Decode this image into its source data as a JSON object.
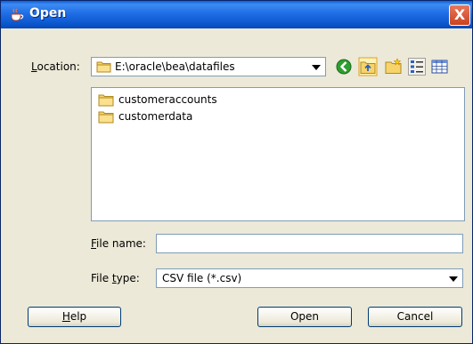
{
  "window": {
    "title": "Open",
    "title_icon": "java-cup-icon",
    "close_glyph": "X"
  },
  "location": {
    "label_underlined": "L",
    "label_rest": "ocation:",
    "value": "E:\\oracle\\bea\\datafiles",
    "icon": "folder-icon"
  },
  "toolbar": [
    {
      "name": "back-icon"
    },
    {
      "name": "up-folder-icon"
    },
    {
      "name": "new-folder-icon"
    },
    {
      "name": "list-view-icon"
    },
    {
      "name": "details-view-icon"
    }
  ],
  "files": [
    {
      "name": "customeraccounts",
      "icon": "folder-icon"
    },
    {
      "name": "customerdata",
      "icon": "folder-icon"
    }
  ],
  "file_name": {
    "label_underlined": "F",
    "label_rest": "ile name:",
    "value": ""
  },
  "file_type": {
    "label_pre": "File ",
    "label_underlined": "t",
    "label_rest": "ype:",
    "value": "CSV file (*.csv)"
  },
  "buttons": {
    "help_underlined": "H",
    "help_rest": "elp",
    "open": "Open",
    "cancel": "Cancel"
  },
  "colors": {
    "title_bar": "#1f6ee6",
    "dialog_bg": "#ece9d8",
    "field_border": "#7f9db9",
    "close": "#d9542c"
  }
}
